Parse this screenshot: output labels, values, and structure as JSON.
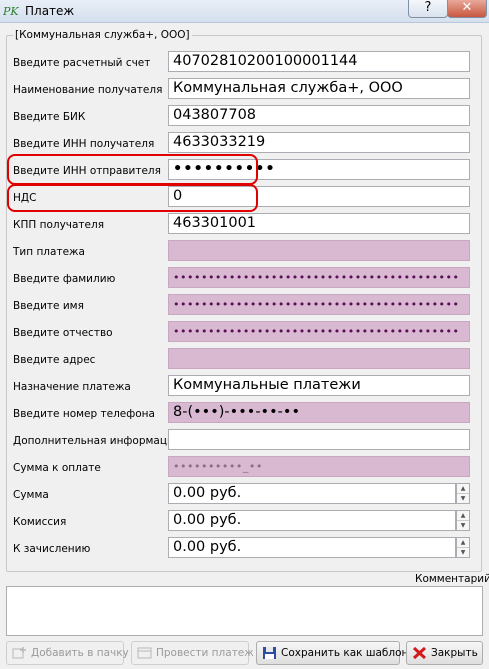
{
  "window": {
    "title": "Платеж"
  },
  "titlebar": {
    "help": "?",
    "close": "✕"
  },
  "group": {
    "title": "[Коммунальная служба+, ООО]"
  },
  "fields": [
    {
      "label": "Введите расчетный счет",
      "value": "40702810200100001144"
    },
    {
      "label": "Наименование получателя",
      "value": "Коммунальная служба+, ООО"
    },
    {
      "label": "Введите БИК",
      "value": "043807708"
    },
    {
      "label": "Введите ИНН получателя",
      "value": "4633033219"
    },
    {
      "label": "Введите ИНН отправителя",
      "value": "••••••••••"
    },
    {
      "label": "НДС",
      "value": "0"
    },
    {
      "label": "КПП получателя",
      "value": "463301001"
    },
    {
      "label": "Тип платежа",
      "value": ""
    },
    {
      "label": "Введите фамилию",
      "value": "•••••••••••••••••••••••••••••••••••••••••"
    },
    {
      "label": "Введите имя",
      "value": "•••••••••••••••••••••••••••••••••••••••••"
    },
    {
      "label": "Введите отчество",
      "value": "•••••••••••••••••••••••••••••••••••••••••"
    },
    {
      "label": "Введите адрес",
      "value": ""
    },
    {
      "label": "Назначение платежа",
      "value": "Коммунальные платежи"
    },
    {
      "label": "Введите номер телефона",
      "value": "8-(•••)-•••-••-••"
    },
    {
      "label": "Дополнительная информация",
      "value": ""
    },
    {
      "label": "Сумма к оплате",
      "value": "••••••••••_••"
    },
    {
      "label": "Сумма",
      "value": "0.00 руб."
    },
    {
      "label": "Комиссия",
      "value": "0.00 руб."
    },
    {
      "label": "К зачислению",
      "value": "0.00 руб."
    }
  ],
  "comment": {
    "label": "Комментарий",
    "value": ""
  },
  "buttons": {
    "add_to_batch": "Добавить в пачку",
    "process_payment": "Провести платеж",
    "save_template": "Сохранить как шаблон",
    "close": "Закрыть"
  }
}
